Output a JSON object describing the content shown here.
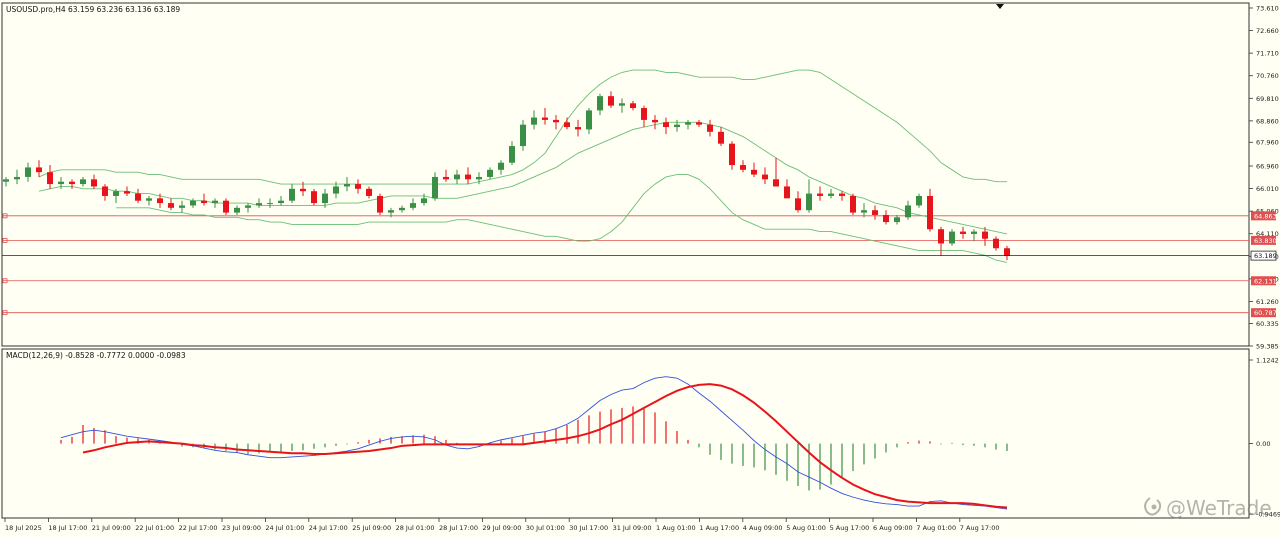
{
  "main": {
    "symbol_info": "USOUSD.pro,H4  63.159 63.236 63.136 63.189",
    "price_axis_labels": [
      "73.610",
      "72.660",
      "71.710",
      "70.760",
      "69.810",
      "68.860",
      "67.960",
      "66.960",
      "66.010",
      "65.060",
      "64.110",
      "63.160",
      "62.210",
      "61.260",
      "60.335",
      "59.385"
    ],
    "price_range": [
      59.385,
      73.61
    ],
    "current_price": {
      "label": "63.189",
      "value": 63.189
    },
    "levels": [
      {
        "label": "64.863",
        "value": 64.863
      },
      {
        "label": "63.830",
        "value": 63.83
      },
      {
        "label": "62.131",
        "value": 62.131
      },
      {
        "label": "60.787",
        "value": 60.787
      }
    ]
  },
  "macd": {
    "info": "MACD(12,26,9) -0.8528 -0.7772 0.0000 -0.0983",
    "axis_labels": [
      "1.1242",
      "0.00",
      "-0.9469"
    ],
    "range": [
      -0.9469,
      1.1242
    ]
  },
  "time_axis_labels": [
    "18 Jul 2025",
    "18 Jul 17:00",
    "21 Jul 09:00",
    "22 Jul 01:00",
    "22 Jul 17:00",
    "23 Jul 09:00",
    "24 Jul 01:00",
    "24 Jul 17:00",
    "25 Jul 09:00",
    "28 Jul 01:00",
    "28 Jul 17:00",
    "29 Jul 09:00",
    "30 Jul 01:00",
    "30 Jul 17:00",
    "31 Jul 09:00",
    "1 Aug 01:00",
    "1 Aug 17:00",
    "4 Aug 09:00",
    "5 Aug 01:00",
    "5 Aug 17:00",
    "6 Aug 09:00",
    "7 Aug 01:00",
    "7 Aug 17:00"
  ],
  "watermark": "@WeTrade",
  "colors": {
    "bg": "#fffff3",
    "bull": "#3a8f46",
    "bear": "#e8141b",
    "band": "#6abf76",
    "level": "#e05050",
    "signal": "#e8141b",
    "macd_line": "#3050e0"
  },
  "chart_data": [
    {
      "type": "candlestick",
      "title": "USOUSD.pro,H4",
      "ylim": [
        59.385,
        73.61
      ],
      "candles": [
        [
          66.3,
          66.5,
          66.1,
          66.4
        ],
        [
          66.4,
          66.8,
          66.2,
          66.5
        ],
        [
          66.5,
          67.1,
          66.3,
          66.9
        ],
        [
          66.9,
          67.2,
          66.5,
          66.7
        ],
        [
          66.7,
          67.0,
          66.0,
          66.2
        ],
        [
          66.2,
          66.5,
          66.0,
          66.3
        ],
        [
          66.3,
          66.4,
          66.0,
          66.2
        ],
        [
          66.2,
          66.5,
          66.1,
          66.4
        ],
        [
          66.4,
          66.6,
          66.0,
          66.1
        ],
        [
          66.1,
          66.2,
          65.5,
          65.7
        ],
        [
          65.7,
          66.0,
          65.4,
          65.9
        ],
        [
          65.9,
          66.1,
          65.7,
          65.8
        ],
        [
          65.8,
          66.0,
          65.4,
          65.5
        ],
        [
          65.5,
          65.7,
          65.3,
          65.6
        ],
        [
          65.6,
          65.8,
          65.2,
          65.4
        ],
        [
          65.4,
          65.6,
          65.1,
          65.2
        ],
        [
          65.2,
          65.5,
          65.0,
          65.3
        ],
        [
          65.3,
          65.6,
          65.2,
          65.5
        ],
        [
          65.5,
          65.8,
          65.3,
          65.4
        ],
        [
          65.4,
          65.6,
          65.2,
          65.5
        ],
        [
          65.5,
          65.6,
          64.9,
          65.0
        ],
        [
          65.0,
          65.3,
          64.9,
          65.2
        ],
        [
          65.2,
          65.4,
          65.0,
          65.3
        ],
        [
          65.3,
          65.6,
          65.2,
          65.4
        ],
        [
          65.4,
          65.6,
          65.2,
          65.4
        ],
        [
          65.4,
          65.7,
          65.3,
          65.5
        ],
        [
          65.5,
          66.2,
          65.4,
          66.0
        ],
        [
          66.0,
          66.3,
          65.7,
          65.9
        ],
        [
          65.9,
          66.0,
          65.3,
          65.4
        ],
        [
          65.4,
          66.0,
          65.2,
          65.8
        ],
        [
          65.8,
          66.3,
          65.6,
          66.1
        ],
        [
          66.1,
          66.5,
          65.9,
          66.2
        ],
        [
          66.2,
          66.4,
          65.8,
          66.0
        ],
        [
          66.0,
          66.1,
          65.6,
          65.7
        ],
        [
          65.7,
          65.8,
          64.9,
          65.0
        ],
        [
          65.0,
          65.2,
          64.8,
          65.1
        ],
        [
          65.1,
          65.3,
          65.0,
          65.2
        ],
        [
          65.2,
          65.6,
          65.1,
          65.4
        ],
        [
          65.4,
          65.8,
          65.3,
          65.6
        ],
        [
          65.6,
          66.7,
          65.5,
          66.5
        ],
        [
          66.5,
          66.8,
          66.3,
          66.4
        ],
        [
          66.4,
          66.8,
          66.2,
          66.6
        ],
        [
          66.6,
          66.9,
          66.2,
          66.4
        ],
        [
          66.4,
          66.7,
          66.2,
          66.5
        ],
        [
          66.5,
          66.9,
          66.4,
          66.8
        ],
        [
          66.8,
          67.2,
          66.6,
          67.1
        ],
        [
          67.1,
          68.0,
          67.0,
          67.8
        ],
        [
          67.8,
          68.9,
          67.6,
          68.7
        ],
        [
          68.7,
          69.3,
          68.5,
          69.0
        ],
        [
          69.0,
          69.4,
          68.7,
          68.9
        ],
        [
          68.9,
          69.1,
          68.5,
          68.8
        ],
        [
          68.8,
          69.0,
          68.5,
          68.6
        ],
        [
          68.6,
          68.9,
          68.2,
          68.5
        ],
        [
          68.5,
          69.4,
          68.3,
          69.3
        ],
        [
          69.3,
          70.0,
          69.1,
          69.9
        ],
        [
          69.9,
          70.1,
          69.4,
          69.5
        ],
        [
          69.5,
          69.8,
          69.2,
          69.6
        ],
        [
          69.6,
          69.7,
          69.3,
          69.4
        ],
        [
          69.4,
          69.5,
          68.6,
          68.9
        ],
        [
          68.9,
          69.1,
          68.5,
          68.8
        ],
        [
          68.8,
          69.0,
          68.3,
          68.6
        ],
        [
          68.6,
          68.9,
          68.4,
          68.7
        ],
        [
          68.7,
          68.9,
          68.5,
          68.8
        ],
        [
          68.8,
          68.9,
          68.6,
          68.7
        ],
        [
          68.7,
          68.9,
          68.2,
          68.4
        ],
        [
          68.4,
          68.6,
          67.8,
          67.9
        ],
        [
          67.9,
          68.0,
          66.8,
          67.0
        ],
        [
          67.0,
          67.2,
          66.7,
          66.8
        ],
        [
          66.8,
          67.1,
          66.5,
          66.6
        ],
        [
          66.6,
          66.9,
          66.2,
          66.4
        ],
        [
          66.4,
          67.3,
          66.2,
          66.1
        ],
        [
          66.1,
          66.4,
          65.8,
          65.6
        ],
        [
          65.6,
          65.9,
          65.0,
          65.1
        ],
        [
          65.1,
          66.4,
          65.0,
          65.8
        ],
        [
          65.8,
          66.1,
          65.5,
          65.7
        ],
        [
          65.7,
          66.0,
          65.6,
          65.8
        ],
        [
          65.8,
          65.9,
          65.5,
          65.7
        ],
        [
          65.7,
          65.8,
          64.9,
          65.0
        ],
        [
          65.0,
          65.4,
          64.8,
          65.1
        ],
        [
          65.1,
          65.3,
          64.7,
          64.9
        ],
        [
          64.9,
          65.1,
          64.5,
          64.6
        ],
        [
          64.6,
          64.9,
          64.5,
          64.8
        ],
        [
          64.8,
          65.5,
          64.7,
          65.3
        ],
        [
          65.3,
          65.8,
          65.2,
          65.7
        ],
        [
          65.7,
          66.0,
          64.2,
          64.3
        ],
        [
          64.3,
          64.4,
          63.2,
          63.7
        ],
        [
          63.7,
          64.3,
          63.6,
          64.2
        ],
        [
          64.2,
          64.4,
          63.9,
          64.1
        ],
        [
          64.1,
          64.3,
          63.8,
          64.2
        ],
        [
          64.2,
          64.4,
          63.6,
          63.9
        ],
        [
          63.9,
          64.0,
          63.4,
          63.5
        ],
        [
          63.5,
          63.6,
          63.0,
          63.19
        ]
      ],
      "bollinger": {
        "upper": [
          66.5,
          66.7,
          66.8,
          66.8,
          66.8,
          66.8,
          66.8,
          66.7,
          66.7,
          66.7,
          66.6,
          66.6,
          66.5,
          66.4,
          66.4,
          66.4,
          66.4,
          66.4,
          66.4,
          66.4,
          66.4,
          66.3,
          66.2,
          66.2,
          66.2,
          66.2,
          66.2,
          66.2,
          66.2,
          66.2,
          66.2,
          66.2,
          66.2,
          66.2,
          66.2,
          66.2,
          66.2,
          66.2,
          66.2,
          66.2,
          66.3,
          66.4,
          66.5,
          66.6,
          66.8,
          67.1,
          67.5,
          68.2,
          68.9,
          69.5,
          70.0,
          70.4,
          70.7,
          70.9,
          71.0,
          71.0,
          71.0,
          70.9,
          70.9,
          70.8,
          70.7,
          70.7,
          70.7,
          70.7,
          70.6,
          70.6,
          70.7,
          70.8,
          70.9,
          71.0,
          71.0,
          70.9,
          70.6,
          70.3,
          70.0,
          69.7,
          69.4,
          69.1,
          68.8,
          68.4,
          68.0,
          67.6,
          67.1,
          66.8,
          66.5,
          66.4,
          66.4,
          66.3,
          66.3
        ],
        "middle": [
          65.9,
          66.0,
          66.1,
          66.1,
          66.0,
          66.0,
          66.0,
          65.9,
          65.9,
          65.8,
          65.8,
          65.7,
          65.6,
          65.6,
          65.5,
          65.5,
          65.4,
          65.4,
          65.4,
          65.4,
          65.3,
          65.3,
          65.3,
          65.3,
          65.3,
          65.3,
          65.3,
          65.4,
          65.4,
          65.4,
          65.5,
          65.6,
          65.7,
          65.7,
          65.7,
          65.7,
          65.6,
          65.6,
          65.6,
          65.7,
          65.8,
          65.9,
          66.0,
          66.1,
          66.3,
          66.5,
          66.7,
          66.9,
          67.2,
          67.5,
          67.7,
          67.9,
          68.1,
          68.3,
          68.5,
          68.6,
          68.7,
          68.8,
          68.8,
          68.8,
          68.8,
          68.7,
          68.6,
          68.4,
          68.2,
          67.9,
          67.6,
          67.3,
          67.0,
          66.8,
          66.5,
          66.3,
          66.1,
          65.9,
          65.7,
          65.6,
          65.4,
          65.3,
          65.2,
          65.0,
          64.9,
          64.8,
          64.7,
          64.6,
          64.5,
          64.4,
          64.3,
          64.2,
          64.1
        ],
        "lower": [
          65.2,
          65.2,
          65.2,
          65.2,
          65.1,
          65.0,
          65.0,
          64.9,
          64.9,
          64.8,
          64.8,
          64.8,
          64.7,
          64.7,
          64.6,
          64.6,
          64.5,
          64.5,
          64.5,
          64.5,
          64.5,
          64.5,
          64.5,
          64.6,
          64.6,
          64.6,
          64.6,
          64.6,
          64.6,
          64.6,
          64.6,
          64.7,
          64.7,
          64.6,
          64.5,
          64.4,
          64.3,
          64.2,
          64.1,
          64.0,
          64.0,
          63.9,
          63.8,
          63.8,
          63.9,
          64.2,
          64.6,
          65.2,
          65.8,
          66.2,
          66.5,
          66.6,
          66.6,
          66.4,
          66.0,
          65.5,
          65.0,
          64.7,
          64.5,
          64.3,
          64.3,
          64.3,
          64.3,
          64.3,
          64.2,
          64.2,
          64.1,
          64.0,
          63.9,
          63.8,
          63.7,
          63.6,
          63.5,
          63.4,
          63.4,
          63.4,
          63.4,
          63.4,
          63.3,
          63.2,
          63.0,
          62.9
        ]
      },
      "horizontal_levels": [
        64.863,
        63.83,
        62.131,
        60.787
      ],
      "current_price": 63.189
    },
    {
      "type": "bar",
      "title": "MACD(12,26,9)",
      "ylim": [
        -0.9469,
        1.1242
      ],
      "histogram": [
        0.05,
        0.09,
        0.25,
        0.21,
        0.18,
        0.1,
        0.08,
        0.07,
        0.05,
        0.03,
        0.0,
        -0.04,
        -0.05,
        -0.06,
        -0.08,
        -0.1,
        -0.12,
        -0.14,
        -0.13,
        -0.12,
        -0.11,
        -0.1,
        -0.09,
        -0.07,
        -0.05,
        -0.03,
        -0.01,
        0.02,
        0.05,
        0.07,
        0.09,
        0.1,
        0.11,
        0.12,
        0.1,
        0.05,
        0.01,
        -0.01,
        -0.03,
        0.01,
        0.04,
        0.07,
        0.1,
        0.13,
        0.16,
        0.2,
        0.25,
        0.32,
        0.38,
        0.43,
        0.46,
        0.48,
        0.5,
        0.47,
        0.42,
        0.3,
        0.17,
        0.05,
        -0.05,
        -0.15,
        -0.22,
        -0.27,
        -0.3,
        -0.32,
        -0.36,
        -0.42,
        -0.5,
        -0.57,
        -0.63,
        -0.62,
        -0.55,
        -0.46,
        -0.37,
        -0.28,
        -0.2,
        -0.12,
        -0.05,
        0.02,
        0.04,
        0.03,
        -0.01,
        0.01,
        -0.02,
        -0.03,
        -0.05,
        -0.08,
        -0.1
      ],
      "macd_line": [
        0.08,
        0.12,
        0.16,
        0.18,
        0.16,
        0.13,
        0.1,
        0.08,
        0.06,
        0.04,
        0.02,
        -0.01,
        -0.03,
        -0.06,
        -0.09,
        -0.11,
        -0.12,
        -0.15,
        -0.17,
        -0.19,
        -0.19,
        -0.18,
        -0.17,
        -0.16,
        -0.14,
        -0.12,
        -0.1,
        -0.07,
        -0.02,
        0.03,
        0.07,
        0.09,
        0.1,
        0.09,
        0.05,
        -0.02,
        -0.06,
        -0.07,
        -0.04,
        0.01,
        0.05,
        0.08,
        0.11,
        0.14,
        0.16,
        0.2,
        0.26,
        0.34,
        0.46,
        0.58,
        0.66,
        0.72,
        0.74,
        0.82,
        0.88,
        0.9,
        0.88,
        0.8,
        0.68,
        0.57,
        0.44,
        0.31,
        0.18,
        0.04,
        -0.08,
        -0.18,
        -0.27,
        -0.38,
        -0.45,
        -0.52,
        -0.6,
        -0.67,
        -0.72,
        -0.76,
        -0.79,
        -0.81,
        -0.82,
        -0.84,
        -0.84,
        -0.78,
        -0.77,
        -0.8,
        -0.82,
        -0.83,
        -0.84,
        -0.86,
        -0.88
      ],
      "signal_line": [
        -0.12,
        -0.09,
        -0.05,
        -0.02,
        0.01,
        0.02,
        0.03,
        0.02,
        0.01,
        0.0,
        -0.02,
        -0.03,
        -0.05,
        -0.06,
        -0.08,
        -0.09,
        -0.1,
        -0.11,
        -0.12,
        -0.13,
        -0.13,
        -0.14,
        -0.14,
        -0.13,
        -0.12,
        -0.11,
        -0.1,
        -0.08,
        -0.06,
        -0.03,
        -0.02,
        -0.01,
        -0.01,
        -0.01,
        -0.01,
        -0.01,
        -0.01,
        -0.01,
        -0.01,
        -0.01,
        -0.01,
        0.01,
        0.03,
        0.05,
        0.07,
        0.1,
        0.14,
        0.19,
        0.26,
        0.32,
        0.4,
        0.48,
        0.56,
        0.64,
        0.71,
        0.76,
        0.79,
        0.8,
        0.78,
        0.73,
        0.65,
        0.55,
        0.43,
        0.3,
        0.16,
        0.02,
        -0.12,
        -0.25,
        -0.36,
        -0.46,
        -0.55,
        -0.62,
        -0.68,
        -0.72,
        -0.76,
        -0.78,
        -0.79,
        -0.8,
        -0.8,
        -0.8,
        -0.8,
        -0.81,
        -0.83,
        -0.85,
        -0.86
      ],
      "zero": 0.0
    }
  ]
}
